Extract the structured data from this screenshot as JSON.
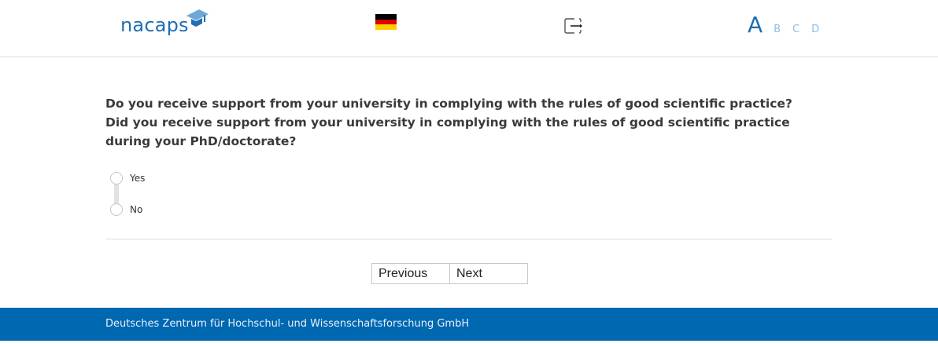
{
  "header": {
    "logo_text": "nacaps",
    "language_flag": "german-flag-icon",
    "exit_icon": "exit-icon",
    "font_sizes": [
      "A",
      "B",
      "C",
      "D"
    ]
  },
  "question": {
    "line1": "Do you receive support from your university in complying with the rules of good scientific practice?",
    "line2": "Did you receive support from your university in complying with the rules of good scientific practice during your PhD/doctorate?"
  },
  "answers": [
    {
      "label": "Yes",
      "selected": false
    },
    {
      "label": "No",
      "selected": false
    }
  ],
  "navigation": {
    "previous_label": "Previous",
    "next_label": "Next"
  },
  "footer": {
    "text": "Deutsches Zentrum für Hochschul- und Wissenschaftsforschung GmbH"
  },
  "colors": {
    "brand": "#1f6fb2",
    "footer": "#0067b1",
    "text": "#3a3a3a"
  }
}
